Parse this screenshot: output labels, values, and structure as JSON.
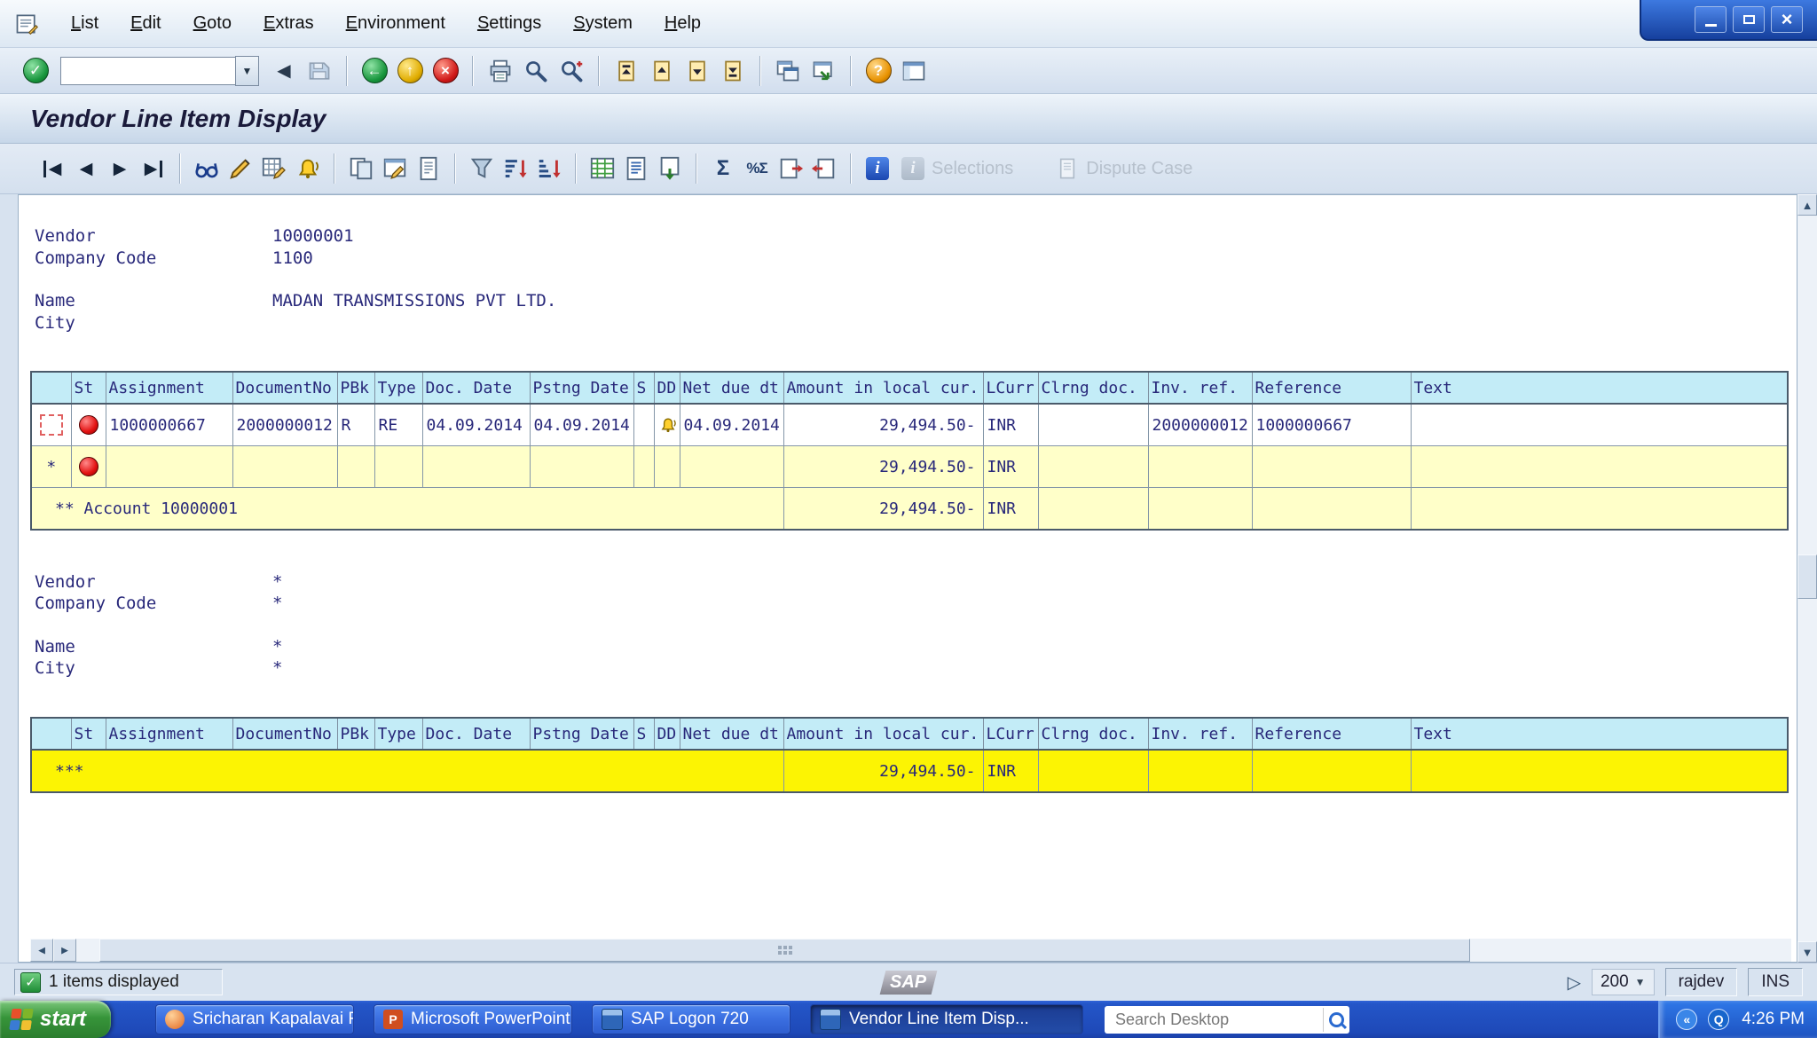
{
  "menubar": {
    "items": [
      "List",
      "Edit",
      "Goto",
      "Extras",
      "Environment",
      "Settings",
      "System",
      "Help"
    ]
  },
  "toolbar": {
    "command_value": ""
  },
  "titlebar": {
    "title": "Vendor Line Item Display"
  },
  "app_toolbar": {
    "selections_label": "Selections",
    "dispute_case_label": "Dispute Case"
  },
  "vendor_block": {
    "vendor_label": "Vendor",
    "vendor_value": "10000001",
    "company_code_label": "Company Code",
    "company_code_value": "1100",
    "name_label": "Name",
    "name_value": "MADAN TRANSMISSIONS PVT LTD.",
    "city_label": "City",
    "city_value": ""
  },
  "summary_block": {
    "vendor_label": "Vendor",
    "vendor_value": "*",
    "company_code_label": "Company Code",
    "company_code_value": "*",
    "name_label": "Name",
    "name_value": "*",
    "city_label": "City",
    "city_value": "*"
  },
  "line_items": {
    "headers": [
      "St",
      "Assignment",
      "DocumentNo",
      "PBk",
      "Type",
      "Doc. Date",
      "Pstng Date",
      "S",
      "DD",
      "Net due dt",
      "Amount in local cur.",
      "LCurr",
      "Clrng doc.",
      "Inv. ref.",
      "Reference",
      "Text"
    ],
    "row": {
      "assignment": "1000000667",
      "document_no": "2000000012",
      "pbk": "R",
      "type": "RE",
      "doc_date": "04.09.2014",
      "pstng_date": "04.09.2014",
      "s": "",
      "net_due_dt": "04.09.2014",
      "amount": "29,494.50-",
      "lcurr": "INR",
      "clrng_doc": "",
      "inv_ref": "2000000012",
      "reference": "1000000667",
      "text": ""
    },
    "subtotal_row": {
      "marker": "*",
      "amount": "29,494.50-",
      "lcurr": "INR"
    },
    "account_row": {
      "label": "** Account 10000001",
      "amount": "29,494.50-",
      "lcurr": "INR"
    },
    "grand_row": {
      "marker": "***",
      "amount": "29,494.50-",
      "lcurr": "INR"
    }
  },
  "status_bar": {
    "message": "1 items displayed",
    "sap_logo": "SAP",
    "page_size": "200",
    "user": "rajdev",
    "mode": "INS"
  },
  "taskbar": {
    "start_label": "start",
    "tasks": [
      "Sricharan Kapalavai R...",
      "Microsoft PowerPoint ...",
      "SAP Logon 720",
      "Vendor Line Item Disp..."
    ],
    "search_placeholder": "Search Desktop",
    "time": "4:26 PM"
  },
  "icons": {
    "enter": "✓",
    "hide_command": "◀",
    "back": "←",
    "exit": "↑",
    "cancel": "×",
    "help": "?",
    "dropdown": "▼",
    "first": "◀",
    "previous": "◀",
    "next": "▶",
    "last": "▶",
    "sum": "Σ",
    "subtotal": "%Σ",
    "info": "i",
    "selections_info": "i",
    "continue": "▷",
    "status_ok": "✓",
    "close": "×",
    "scroll_up": "▲",
    "scroll_down": "▼",
    "scroll_left": "◀",
    "scroll_right": "▶",
    "tray_hide": "«",
    "tray_q": "Q"
  }
}
